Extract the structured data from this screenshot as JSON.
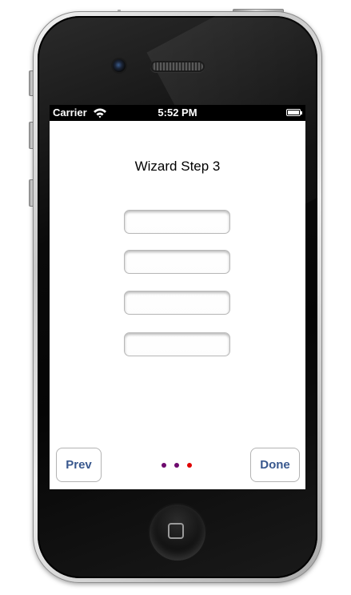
{
  "status_bar": {
    "carrier": "Carrier",
    "time": "5:52 PM",
    "wifi_icon": "wifi-icon",
    "battery_icon": "battery-icon"
  },
  "wizard": {
    "title": "Wizard Step 3",
    "fields": [
      {
        "value": "",
        "placeholder": ""
      },
      {
        "value": "",
        "placeholder": ""
      },
      {
        "value": "",
        "placeholder": ""
      },
      {
        "value": "",
        "placeholder": ""
      }
    ],
    "prev_label": "Prev",
    "done_label": "Done",
    "page_indicator": {
      "count": 3,
      "current": 3,
      "colors": [
        "#6e0a6e",
        "#6e0a6e",
        "#e00000"
      ]
    }
  },
  "colors": {
    "button_text": "#39588e",
    "status_bar_bg": "#000000"
  }
}
